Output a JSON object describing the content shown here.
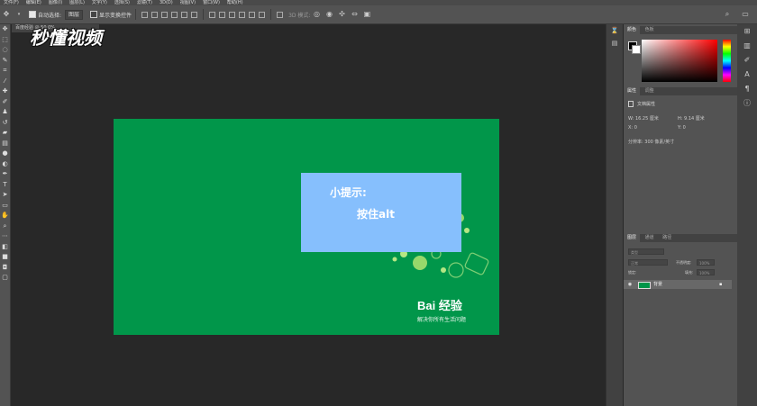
{
  "menubar": [
    "文件(F)",
    "编辑(E)",
    "图像(I)",
    "图层(L)",
    "文字(Y)",
    "选择(S)",
    "滤镜(T)",
    "3D(D)",
    "视图(V)",
    "窗口(W)",
    "帮助(H)"
  ],
  "options": {
    "auto_select_label": "自动选择:",
    "auto_select_value": "图层",
    "transform_label": "显示变换控件",
    "mode_3d_label": "3D 模式:"
  },
  "document": {
    "tab_label": "百度经验 @ 50.0%",
    "tip_line1": "小提示:",
    "tip_line2": "按住alt",
    "baidu_logo": "Bai 经验",
    "baidu_slogan": "解决你所有生活问题"
  },
  "watermark": "秒懂视频",
  "panels": {
    "color_tabs": [
      "颜色",
      "色板"
    ],
    "props_tabs": [
      "属性",
      "调整"
    ],
    "props_title": "文档属性",
    "width_label": "W:",
    "width_value": "16.25 厘米",
    "height_label": "H:",
    "height_value": "9.14 厘米",
    "x_label": "X:",
    "x_value": "0",
    "y_label": "Y:",
    "y_value": "0",
    "resolution": "分辨率: 300 像素/英寸",
    "layers_tabs": [
      "图层",
      "通道",
      "路径"
    ],
    "kind_label": "类型",
    "blend_mode": "正常",
    "opacity_label": "不透明度:",
    "opacity_value": "100%",
    "lock_label": "锁定:",
    "fill_label": "填充:",
    "fill_value": "100%",
    "layer_name": "背景"
  },
  "colors": {
    "canvas_green": "#01964a",
    "tip_blue": "#86bffd",
    "ui_bg": "#535353",
    "workspace": "#282828"
  }
}
